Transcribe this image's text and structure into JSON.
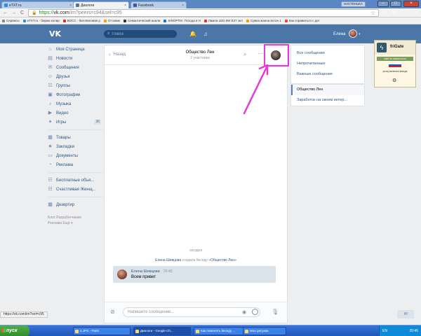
{
  "browser": {
    "tabs": [
      {
        "title": "eTXT.ru",
        "color": "#2d8fd8"
      },
      {
        "title": "Диалоги",
        "color": "#4a76a8"
      },
      {
        "title": "Facebook",
        "color": "#3b5998"
      }
    ],
    "window_user": "НАСТЕНЬКА",
    "window_buttons": [
      "–",
      "□",
      "×"
    ],
    "nav": {
      "back": "←",
      "forward": "→",
      "reload": "C"
    },
    "url": {
      "protocol": "https://",
      "host": "vk.com",
      "path": "/im?peers=c94&sel=c95"
    },
    "bookmarks": [
      "Сервисы",
      "eTXT.ru - биржа копир",
      "ВОСС - биллинговая р",
      "Отзовик",
      "Семантический анали",
      "SINOPTIK: Погода в Н",
      "Лампа LED 5W E27 зел",
      "Сумка жанна вхтон 1",
      "Как справиться с дет"
    ],
    "extensions": [
      {
        "label": "S",
        "color": "#4a76a8"
      },
      {
        "label": "M",
        "color": "#c22"
      },
      {
        "label": "f",
        "color": "#2e7d32"
      },
      {
        "label": "*",
        "color": "#d4a017"
      },
      {
        "label": "≡",
        "color": "#777"
      }
    ],
    "status_url": "https://vk.com/im?sel=c95"
  },
  "vk": {
    "logo": "VK",
    "search_placeholder": "Поиск",
    "user_name": "Елена",
    "menu": [
      {
        "label": "Моя Страница",
        "icon": "⌂"
      },
      {
        "label": "Новости",
        "icon": "▤"
      },
      {
        "label": "Сообщения",
        "icon": "✉"
      },
      {
        "label": "Друзья",
        "icon": "☺"
      },
      {
        "label": "Группы",
        "icon": "☷"
      },
      {
        "label": "Фотографии",
        "icon": "▣"
      },
      {
        "label": "Музыка",
        "icon": "♪"
      },
      {
        "label": "Видео",
        "icon": "▶"
      },
      {
        "label": "Игры",
        "icon": "✦",
        "count": "36"
      }
    ],
    "menu2": [
      {
        "label": "Товары",
        "icon": "▦"
      },
      {
        "label": "Закладки",
        "icon": "★"
      },
      {
        "label": "Документы",
        "icon": "▭"
      },
      {
        "label": "Реклама",
        "icon": "◔"
      }
    ],
    "menu3": [
      {
        "label": "Бесплатные объя...",
        "icon": "☷"
      },
      {
        "label": "Счастливая Женщ...",
        "icon": "☷"
      }
    ],
    "menu4": [
      {
        "label": "Дезертир",
        "icon": "▦"
      }
    ],
    "footer_line1": "Блог   Разработчикам",
    "footer_line2": "Реклама   Ещё ▾"
  },
  "dialog": {
    "back_label": "Назад",
    "title": "Общество Лен",
    "subtitle": "2 участника",
    "date_separator": "сегодня",
    "service_author": "Елена Шевцова",
    "service_text": "создала беседу",
    "service_chat": "«Общество Лен»",
    "message": {
      "author": "Елена Шевцова",
      "time": "20:45",
      "text": "Всем привет"
    },
    "input_placeholder": "Напишите сообщение..."
  },
  "filters": [
    "Все сообщения",
    "Непрочитанные",
    "Важные сообщения"
  ],
  "conversations": [
    {
      "label": "Общество Лен",
      "active": true
    },
    {
      "label": "Заработок на своем интер...",
      "active": false
    }
  ],
  "frigate": {
    "name": "friGate",
    "bar_text": "сайт из списка есть",
    "note": "proxy включен всегда"
  },
  "taskbar": {
    "start": "пуск",
    "tasks": [
      {
        "label": "4.JPG - Paint",
        "active": false
      },
      {
        "label": "Диалоги - Google Ch...",
        "active": true
      },
      {
        "label": "Как поменять беседу ...",
        "active": false
      },
      {
        "label": "Мои рисунки",
        "active": false
      }
    ],
    "lang": "EN",
    "clock": "20:46"
  },
  "colors": {
    "vk_blue": "#4a76a8",
    "link": "#2a5885",
    "highlight": "#e63ad6"
  }
}
